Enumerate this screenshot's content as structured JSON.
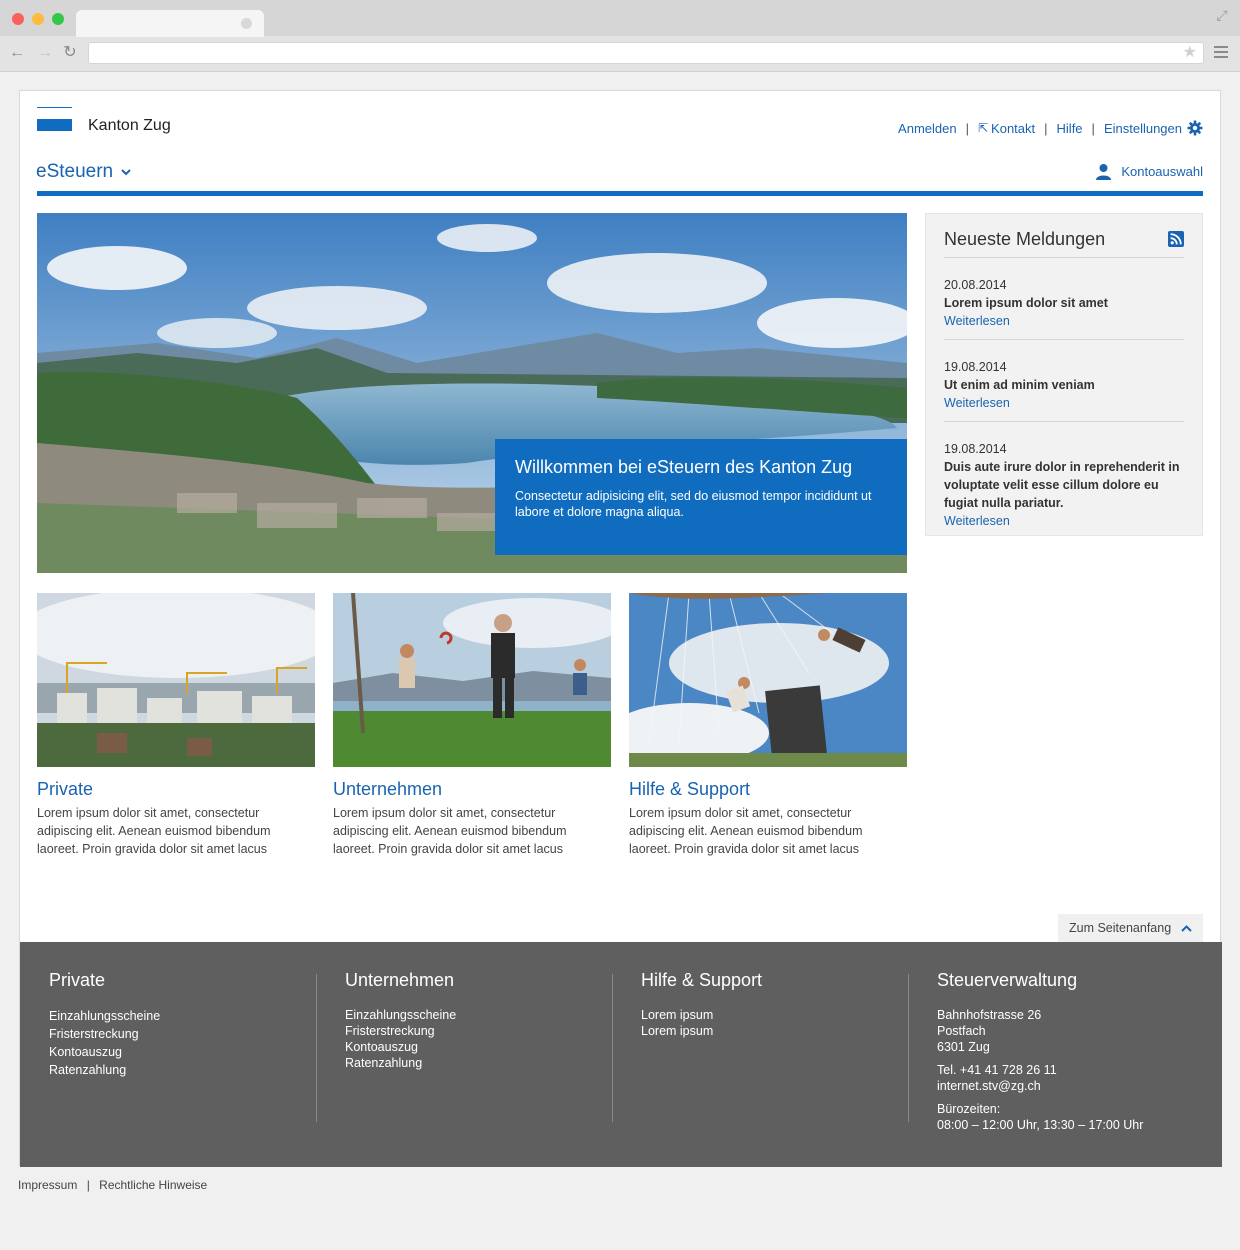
{
  "header": {
    "brand": "Kanton Zug",
    "links": {
      "login": "Anmelden",
      "contact": "Kontakt",
      "help": "Hilfe",
      "settings": "Einstellungen"
    },
    "app_menu": "eSteuern",
    "account": "Kontoauswahl"
  },
  "hero": {
    "title": "Willkommen bei eSteuern des Kanton Zug",
    "text": "Consectetur adipisicing elit, sed do eiusmod tempor incididunt ut labore et dolore magna aliqua."
  },
  "news": {
    "title": "Neueste Meldungen",
    "items": [
      {
        "date": "20.08.2014",
        "text": "Lorem ipsum dolor sit amet",
        "link": "Weiterlesen"
      },
      {
        "date": "19.08.2014",
        "text": "Ut enim ad minim veniam",
        "link": "Weiterlesen"
      },
      {
        "date": "19.08.2014",
        "text": "Duis aute irure dolor in reprehenderit in voluptate velit esse cillum dolore eu fugiat nulla pariatur.",
        "link": "Weiterlesen"
      }
    ]
  },
  "cards": [
    {
      "title": "Private",
      "text": "Lorem ipsum dolor sit amet, consectetur adipiscing elit. Aenean euismod bibendum laoreet. Proin gravida dolor sit amet lacus"
    },
    {
      "title": "Unternehmen",
      "text": "Lorem ipsum dolor sit amet, consectetur adipiscing elit. Aenean euismod bibendum laoreet. Proin gravida dolor sit amet lacus"
    },
    {
      "title": "Hilfe & Support",
      "text": "Lorem ipsum dolor sit amet, consectetur adipiscing elit. Aenean euismod bibendum laoreet. Proin gravida dolor sit amet lacus"
    }
  ],
  "to_top": "Zum Seitenanfang",
  "footer": {
    "private": {
      "title": "Private",
      "links": [
        "Einzahlungsscheine",
        "Fristerstreckung",
        "Kontoauszug",
        "Ratenzahlung"
      ]
    },
    "business": {
      "title": "Unternehmen",
      "links": [
        "Einzahlungsscheine",
        "Fristerstreckung",
        "Kontoauszug",
        "Ratenzahlung"
      ]
    },
    "support": {
      "title": "Hilfe & Support",
      "links": [
        "Lorem ipsum",
        "Lorem ipsum"
      ]
    },
    "admin": {
      "title": "Steuerverwaltung",
      "address": [
        "Bahnhofstrasse 26",
        "Postfach",
        "6301 Zug"
      ],
      "phone": "Tel. +41 41 728 26 11",
      "email": "internet.stv@zg.ch",
      "hours_label": "Bürozeiten:",
      "hours": "08:00 – 12:00 Uhr, 13:30 – 17:00 Uhr"
    }
  },
  "bottom_links": {
    "imprint": "Impressum",
    "legal": "Rechtliche Hinweise"
  },
  "colors": {
    "accent": "#0f6cbf",
    "footer": "#5f5f5f"
  }
}
